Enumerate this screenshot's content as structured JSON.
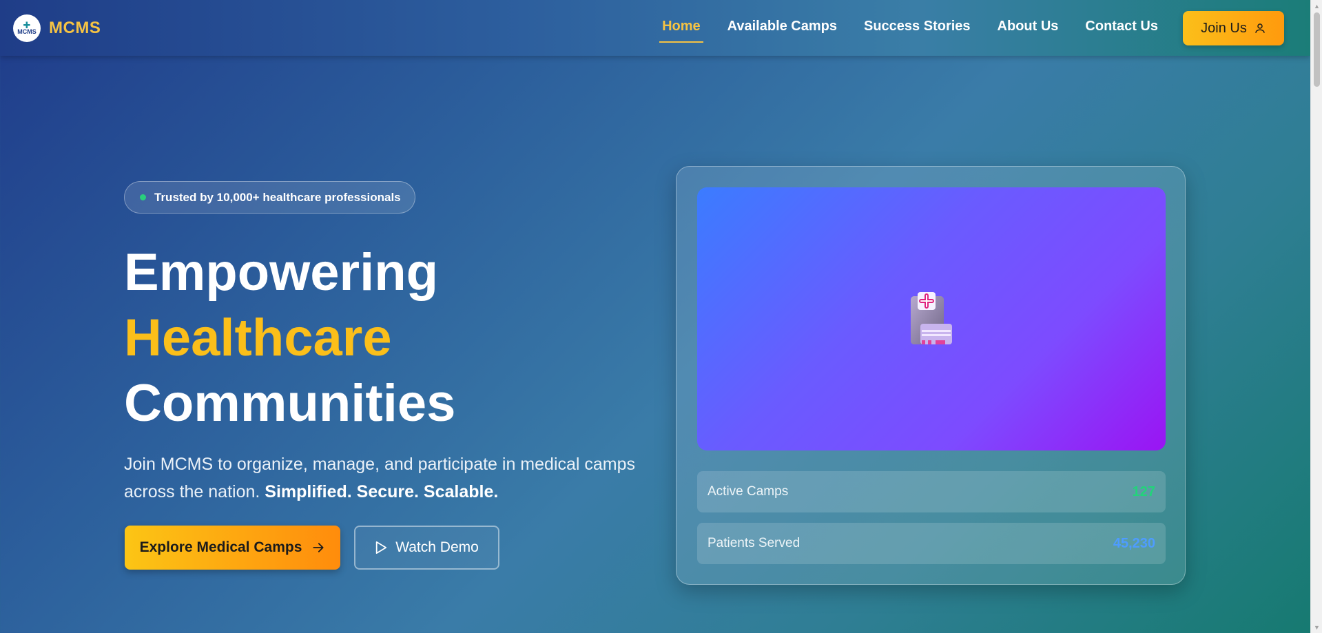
{
  "brand": {
    "logo_text": "MCMS",
    "name": "MCMS"
  },
  "nav": {
    "items": [
      {
        "label": "Home",
        "active": true
      },
      {
        "label": "Available Camps"
      },
      {
        "label": "Success Stories"
      },
      {
        "label": "About Us"
      },
      {
        "label": "Contact Us"
      }
    ],
    "join_label": "Join Us",
    "join_icon": "user-icon"
  },
  "hero": {
    "badge": "Trusted by 10,000+ healthcare professionals",
    "headline_line1": "Empowering",
    "headline_line2": "Healthcare",
    "headline_line3": "Communities",
    "subtext_main": "Join MCMS to organize, manage, and participate in medical camps across the nation.",
    "subtext_strong": "Simplified. Secure. Scalable.",
    "primary_cta": "Explore Medical Camps",
    "secondary_cta": "Watch Demo"
  },
  "card": {
    "image_icon": "hospital-icon",
    "stats": [
      {
        "label": "Active Camps",
        "value": "127"
      },
      {
        "label": "Patients Served",
        "value": "45,230"
      }
    ]
  },
  "colors": {
    "accent": "#fbbf1a",
    "active_nav": "#f6c343",
    "stat_green": "#22d47a",
    "stat_blue": "#4e9cff"
  }
}
